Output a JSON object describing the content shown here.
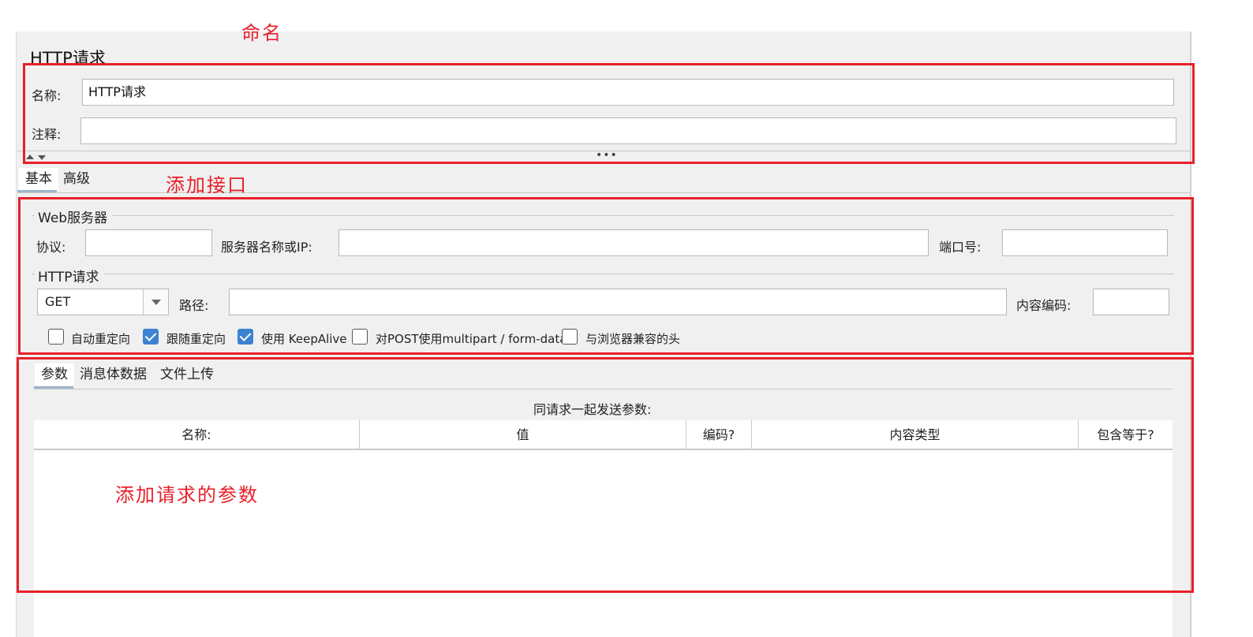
{
  "panel": {
    "title": "HTTP请求"
  },
  "name_section": {
    "name_label": "名称:",
    "name_value": "HTTP请求",
    "comment_label": "注释:",
    "comment_value": ""
  },
  "tabs": [
    {
      "label": "基本",
      "active": true
    },
    {
      "label": "高级",
      "active": false
    }
  ],
  "web_server": {
    "legend": "Web服务器",
    "protocol_label": "协议:",
    "protocol_value": "",
    "server_label": "服务器名称或IP:",
    "server_value": "",
    "port_label": "端口号:",
    "port_value": ""
  },
  "http_request": {
    "legend": "HTTP请求",
    "method": "GET",
    "path_label": "路径:",
    "path_value": "",
    "encoding_label": "内容编码:",
    "encoding_value": ""
  },
  "options": [
    {
      "label": "自动重定向",
      "checked": false
    },
    {
      "label": "跟随重定向",
      "checked": true
    },
    {
      "label": "使用 KeepAlive",
      "checked": true
    },
    {
      "label": "对POST使用multipart / form-data",
      "checked": false
    },
    {
      "label": "与浏览器兼容的头",
      "checked": false
    }
  ],
  "sub_tabs": [
    {
      "label": "参数",
      "active": true
    },
    {
      "label": "消息体数据",
      "active": false
    },
    {
      "label": "文件上传",
      "active": false
    }
  ],
  "params": {
    "caption": "同请求一起发送参数:",
    "columns": [
      "名称:",
      "值",
      "编码?",
      "内容类型",
      "包含等于?"
    ]
  },
  "annotations": {
    "naming": "命名",
    "add_interface": "添加接口",
    "add_params": "添加请求的参数",
    "color": "#e8202a"
  },
  "accent_color": "#3c82d2"
}
